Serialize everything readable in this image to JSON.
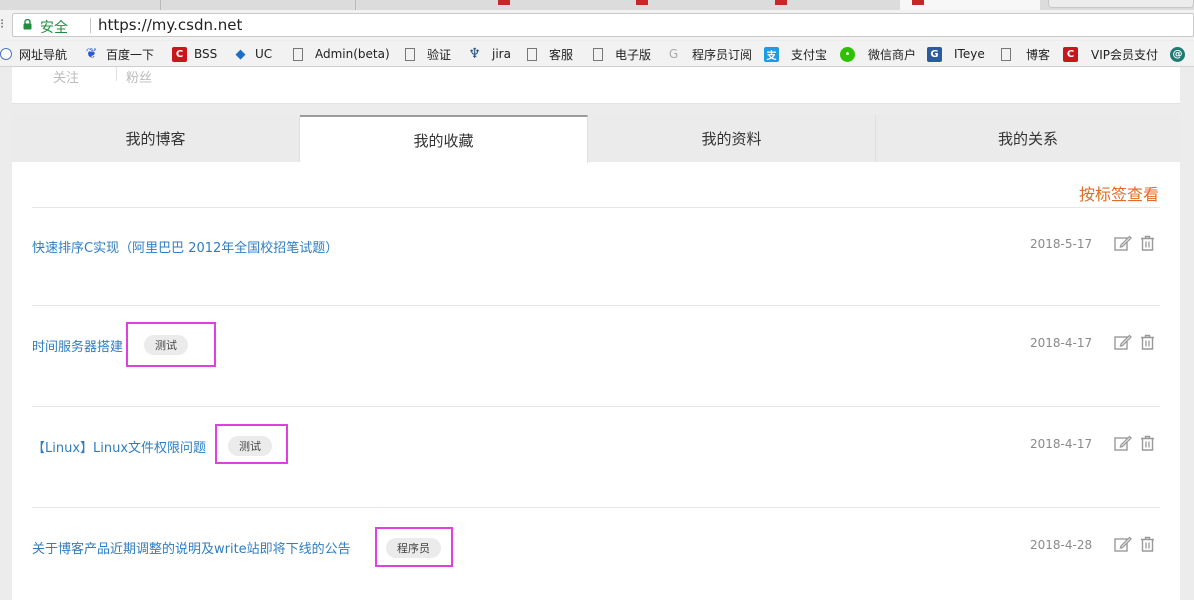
{
  "browser": {
    "security_label": "安全",
    "url": "https://my.csdn.net",
    "bookmarks": [
      {
        "label": "网址导航",
        "icon": "globe-icon"
      },
      {
        "label": "百度一下",
        "icon": "baidu-paw-icon"
      },
      {
        "label": "BSS",
        "icon": "csdn-c-icon"
      },
      {
        "label": "UC",
        "icon": "diamond-arrows-icon"
      },
      {
        "label": "Admin(beta)",
        "icon": "page-icon"
      },
      {
        "label": "验证",
        "icon": "page-icon"
      },
      {
        "label": "jira",
        "icon": "jira-icon"
      },
      {
        "label": "客服",
        "icon": "page-icon"
      },
      {
        "label": "电子版",
        "icon": "page-icon"
      },
      {
        "label": "程序员订阅",
        "icon": "grey-g-icon"
      },
      {
        "label": "支付宝",
        "icon": "alipay-icon"
      },
      {
        "label": "微信商户",
        "icon": "wechat-icon"
      },
      {
        "label": "ITeye",
        "icon": "iteye-icon"
      },
      {
        "label": "博客",
        "icon": "page-icon"
      },
      {
        "label": "VIP会员支付",
        "icon": "csdn-c-icon"
      },
      {
        "label": "",
        "icon": "at-icon"
      }
    ]
  },
  "profile": {
    "follow_label": "关注",
    "fans_label": "粉丝"
  },
  "tabs": [
    {
      "label": "我的博客",
      "active": false
    },
    {
      "label": "我的收藏",
      "active": true
    },
    {
      "label": "我的资料",
      "active": false
    },
    {
      "label": "我的关系",
      "active": false
    }
  ],
  "tag_view_link": "按标签查看",
  "favorites": [
    {
      "title": "快速排序C实现（阿里巴巴 2012年全国校招笔试题）",
      "tag": "",
      "date": "2018-5-17"
    },
    {
      "title": "时间服务器搭建",
      "tag": "测试",
      "date": "2018-4-17"
    },
    {
      "title": "【Linux】Linux文件权限问题",
      "tag": "测试",
      "date": "2018-4-17"
    },
    {
      "title": "关于博客产品近期调整的说明及write站即将下线的公告",
      "tag": "程序员",
      "date": "2018-4-28"
    }
  ],
  "colors": {
    "link": "#2f7dc0",
    "accent": "#e36b27",
    "highlight": "#e040e0",
    "secure": "#1e8e3e"
  }
}
